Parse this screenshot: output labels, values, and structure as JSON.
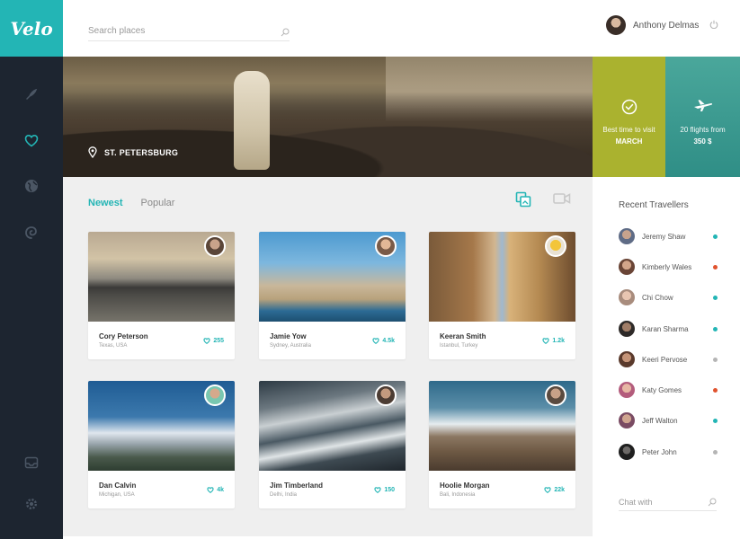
{
  "app": {
    "logo_text": "Velo"
  },
  "colors": {
    "accent": "#23b5b5",
    "sidebar": "#1d2530",
    "tile_time": "#aab22f",
    "tile_flights": "#3a9a90"
  },
  "header": {
    "search_placeholder": "Search places",
    "user_name": "Anthony Delmas"
  },
  "sidebar": {
    "items": [
      {
        "icon": "feather-icon"
      },
      {
        "icon": "heart-icon",
        "active": true
      },
      {
        "icon": "globe-icon"
      },
      {
        "icon": "swirl-icon"
      },
      {
        "icon": "inbox-icon"
      },
      {
        "icon": "gear-icon"
      }
    ]
  },
  "hero": {
    "location": "ST. PETERSBURG",
    "tile_time": {
      "line1": "Best time to visit",
      "line2": "MARCH"
    },
    "tile_flights": {
      "line1": "20 flights from",
      "line2": "350 $"
    }
  },
  "tabs": [
    {
      "label": "Newest",
      "active": true
    },
    {
      "label": "Popular",
      "active": false
    }
  ],
  "cards": [
    {
      "name": "Cory Peterson",
      "location": "Texas, USA",
      "likes": "255"
    },
    {
      "name": "Jamie Yow",
      "location": "Sydney, Australia",
      "likes": "4.5k"
    },
    {
      "name": "Keeran Smith",
      "location": "Istanbul, Turkey",
      "likes": "1.2k"
    },
    {
      "name": "Dan Calvin",
      "location": "Michigan, USA",
      "likes": "4k"
    },
    {
      "name": "Jim Timberland",
      "location": "Delhi, India",
      "likes": "150"
    },
    {
      "name": "Hoolie Morgan",
      "location": "Bali, Indonesia",
      "likes": "22k"
    }
  ],
  "recent_travellers": {
    "title": "Recent Travellers",
    "items": [
      {
        "name": "Jeremy Shaw",
        "status_color": "#23b5b5"
      },
      {
        "name": "Kimberly Wales",
        "status_color": "#e0532e"
      },
      {
        "name": "Chi Chow",
        "status_color": "#23b5b5"
      },
      {
        "name": "Karan Sharma",
        "status_color": "#23b5b5"
      },
      {
        "name": "Keeri Pervose",
        "status_color": "#b5b5b5"
      },
      {
        "name": "Katy Gomes",
        "status_color": "#e0532e"
      },
      {
        "name": "Jeff Walton",
        "status_color": "#23b5b5"
      },
      {
        "name": "Peter John",
        "status_color": "#b5b5b5"
      }
    ],
    "chat_placeholder": "Chat with"
  }
}
